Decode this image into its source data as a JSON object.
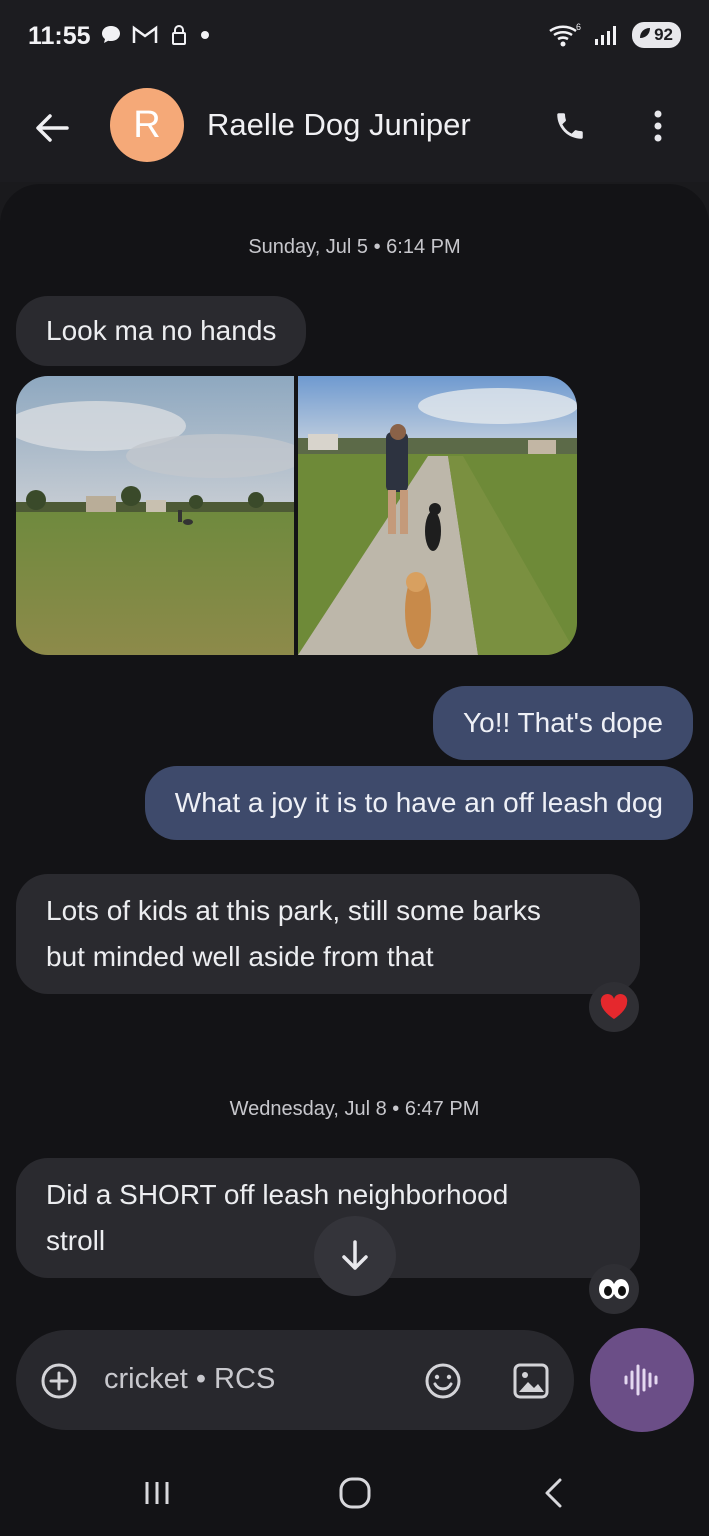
{
  "status": {
    "time": "11:55",
    "battery": "92",
    "wifi_badge": "6"
  },
  "header": {
    "avatar_letter": "R",
    "contact_name": "Raelle Dog Juniper"
  },
  "messages": {
    "date1": "Sunday, Jul 5 • 6:14 PM",
    "m1": "Look ma no hands",
    "m2": "Yo!! That's dope",
    "m3": "What a joy it is to have an off leash dog",
    "m4_line1": "Lots of kids at this park, still some barks",
    "m4_line2": "but minded well aside from that",
    "date2": "Wednesday, Jul 8 • 6:47 PM",
    "m5_line1": "Did a SHORT off leash neighborhood",
    "m5_line2": "stroll"
  },
  "compose": {
    "placeholder": "cricket • RCS"
  },
  "colors": {
    "accent_voice": "#6b4e87",
    "outgoing_bubble": "#3e4a6b",
    "incoming_bubble": "#2a2a2f",
    "avatar": "#f5a978"
  }
}
